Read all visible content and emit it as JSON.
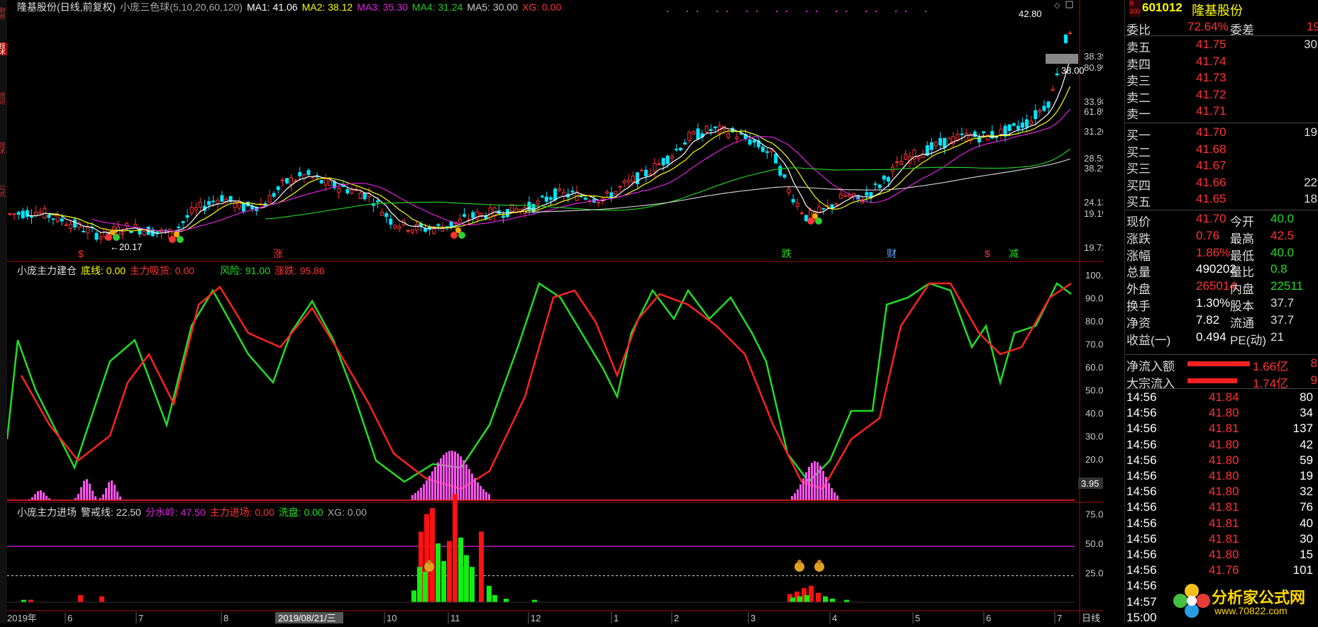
{
  "left_tabs": [
    "财务",
    "技术",
    "资讯",
    "技术",
    "公式"
  ],
  "chart_header": {
    "title": "隆基股份(日线,前复权)",
    "indicator": "小庞三色球(5,10,20,60,120)",
    "ma1": "MA1: 41.06",
    "ma2": "MA2: 38.12",
    "ma3": "MA3: 35.30",
    "ma4": "MA4: 31.24",
    "ma5": "MA5: 30.00",
    "xg": "XG: 0.00"
  },
  "main_axis": [
    "42.80",
    "38.39",
    "80.9%",
    "38.00",
    "33.98",
    "61.8%",
    "31.26",
    "28.53",
    "38.2%",
    "24.13",
    "19.1%",
    "19.72",
    "20.17"
  ],
  "main_markers": [
    "$",
    "涨",
    "跌",
    "财",
    "$",
    "减"
  ],
  "panel2_header": {
    "name": "小庞主力建仓",
    "bottom": "底线: 0.00",
    "absorb": "主力吸货: 0.00",
    "risk": "风险: 91.00",
    "rise": "涨跌: 95.86"
  },
  "panel2_axis": [
    "100.0",
    "90.00",
    "80.00",
    "70.00",
    "60.00",
    "50.00",
    "40.00",
    "30.00",
    "20.00",
    "3.95"
  ],
  "panel3_header": {
    "name": "小庞主力进场",
    "warn": "警戒线: 22.50",
    "divide": "分水岭: 47.50",
    "enter": "主力进场: 0.00",
    "wash": "洗盘: 0.00",
    "xg": "XG: 0.00"
  },
  "panel3_axis": [
    "75.00",
    "50.00",
    "25.00"
  ],
  "x_axis": [
    "2019年",
    "6",
    "7",
    "8",
    "2019/08/21/三",
    "10",
    "11",
    "12",
    "1",
    "2",
    "3",
    "4",
    "5",
    "6",
    "7",
    "日线"
  ],
  "quote": {
    "code": "601012",
    "name": "隆基股份",
    "weibi_label": "委比",
    "weibi": "72.64%",
    "weicha_label": "委差",
    "weicha": "19",
    "asks": [
      {
        "label": "卖五",
        "price": "41.75",
        "vol": "30"
      },
      {
        "label": "卖四",
        "price": "41.74",
        "vol": ""
      },
      {
        "label": "卖三",
        "price": "41.73",
        "vol": ""
      },
      {
        "label": "卖二",
        "price": "41.72",
        "vol": ""
      },
      {
        "label": "卖一",
        "price": "41.71",
        "vol": ""
      }
    ],
    "bids": [
      {
        "label": "买一",
        "price": "41.70",
        "vol": "19"
      },
      {
        "label": "买二",
        "price": "41.68",
        "vol": ""
      },
      {
        "label": "买三",
        "price": "41.67",
        "vol": ""
      },
      {
        "label": "买四",
        "price": "41.66",
        "vol": "22"
      },
      {
        "label": "买五",
        "price": "41.65",
        "vol": "18"
      }
    ],
    "stats": [
      {
        "l1": "现价",
        "v1": "41.70",
        "l2": "今开",
        "v2": "40.0"
      },
      {
        "l1": "涨跌",
        "v1": "0.76",
        "l2": "最高",
        "v2": "42.5"
      },
      {
        "l1": "涨幅",
        "v1": "1.86%",
        "l2": "最低",
        "v2": "40.0"
      },
      {
        "l1": "总量",
        "v1": "490202",
        "l2": "量比",
        "v2": "0.8"
      },
      {
        "l1": "外盘",
        "v1": "265014",
        "l2": "内盘",
        "v2": "22511"
      },
      {
        "l1": "换手",
        "v1": "1.30%",
        "l2": "股本",
        "v2": "37.7"
      },
      {
        "l1": "净资",
        "v1": "7.82",
        "l2": "流通",
        "v2": "37.7"
      },
      {
        "l1": "收益(一)",
        "v1": "0.494",
        "l2": "PE(动)",
        "v2": "21"
      }
    ],
    "flows": [
      {
        "label": "净流入额",
        "value": "1.66亿",
        "extra": "8"
      },
      {
        "label": "大宗流入",
        "value": "1.74亿",
        "extra": "9"
      }
    ],
    "ticks": [
      {
        "t": "14:56",
        "p": "41.84",
        "v": "80"
      },
      {
        "t": "14:56",
        "p": "41.80",
        "v": "34"
      },
      {
        "t": "14:56",
        "p": "41.81",
        "v": "137"
      },
      {
        "t": "14:56",
        "p": "41.80",
        "v": "42"
      },
      {
        "t": "14:56",
        "p": "41.80",
        "v": "59"
      },
      {
        "t": "14:56",
        "p": "41.80",
        "v": "19"
      },
      {
        "t": "14:56",
        "p": "41.80",
        "v": "32"
      },
      {
        "t": "14:56",
        "p": "41.81",
        "v": "76"
      },
      {
        "t": "14:56",
        "p": "41.81",
        "v": "40"
      },
      {
        "t": "14:56",
        "p": "41.81",
        "v": "30"
      },
      {
        "t": "14:56",
        "p": "41.80",
        "v": "15"
      },
      {
        "t": "14:56",
        "p": "41.76",
        "v": "101"
      },
      {
        "t": "14:56",
        "p": "",
        "v": ""
      },
      {
        "t": "14:57",
        "p": "",
        "v": ""
      },
      {
        "t": "15:00",
        "p": "",
        "v": ""
      }
    ]
  },
  "logo": {
    "text": "分析家公式网",
    "url": "www.70822.com"
  },
  "colors": {
    "up": "#ff3333",
    "down": "#00e5ff",
    "ma1": "#ffffff",
    "ma2": "#ffff00",
    "ma3": "#e020e0",
    "ma4": "#22cc22",
    "ma5": "#cccccc",
    "k_line": "#22dd22",
    "d_line": "#ff2222",
    "pink": "#ff55ee",
    "hist_red": "#ff1111",
    "hist_green": "#11ee11"
  }
}
